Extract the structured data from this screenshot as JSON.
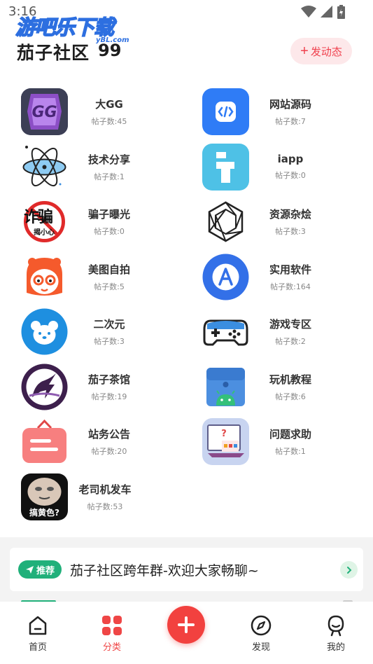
{
  "status_bar": {
    "time": "3:16"
  },
  "watermark": {
    "main": "游吧乐下载",
    "sub": "yBL.com"
  },
  "header": {
    "title": "茄子社区",
    "quote": "99",
    "post_button": "发动态"
  },
  "categories": [
    {
      "name": "大GG",
      "count": "帖子数:45",
      "icon": "gg-logo-icon"
    },
    {
      "name": "网站源码",
      "count": "帖子数:7",
      "icon": "code-icon"
    },
    {
      "name": "技术分享",
      "count": "帖子数:1",
      "icon": "atom-icon"
    },
    {
      "name": "iapp",
      "count": "帖子数:0",
      "icon": "iapp-icon"
    },
    {
      "name": "骗子曝光",
      "count": "帖子数:0",
      "icon": "fraud-warning-icon"
    },
    {
      "name": "资源杂烩",
      "count": "帖子数:3",
      "icon": "hexagon-knot-icon"
    },
    {
      "name": "美图自拍",
      "count": "帖子数:5",
      "icon": "cartoon-face-icon"
    },
    {
      "name": "实用软件",
      "count": "帖子数:164",
      "icon": "app-store-icon"
    },
    {
      "name": "二次元",
      "count": "帖子数:3",
      "icon": "bear-icon"
    },
    {
      "name": "游戏专区",
      "count": "帖子数:2",
      "icon": "gamepad-icon"
    },
    {
      "name": "茄子茶馆",
      "count": "帖子数:19",
      "icon": "tea-house-icon"
    },
    {
      "name": "玩机教程",
      "count": "帖子数:6",
      "icon": "android-box-icon"
    },
    {
      "name": "站务公告",
      "count": "帖子数:20",
      "icon": "notice-board-icon"
    },
    {
      "name": "问题求助",
      "count": "帖子数:1",
      "icon": "help-screen-icon"
    },
    {
      "name": "老司机发车",
      "count": "帖子数:53",
      "icon": "meme-face-icon",
      "icon_caption": "搞黄色?"
    }
  ],
  "fraud_icon_text": {
    "top": "诈骗",
    "bottom": "揭小心"
  },
  "notice": {
    "tag": "推荐",
    "text": "茄子社区跨年群-欢迎大家畅聊~"
  },
  "nav": [
    {
      "label": "首页",
      "icon": "home-icon"
    },
    {
      "label": "分类",
      "icon": "category-icon",
      "active": true
    },
    {
      "label": "发现",
      "icon": "compass-icon"
    },
    {
      "label": "我的",
      "icon": "profile-icon"
    }
  ],
  "colors": {
    "accent": "#f2413f",
    "green": "#20b07a",
    "blue": "#2d6fe0"
  }
}
